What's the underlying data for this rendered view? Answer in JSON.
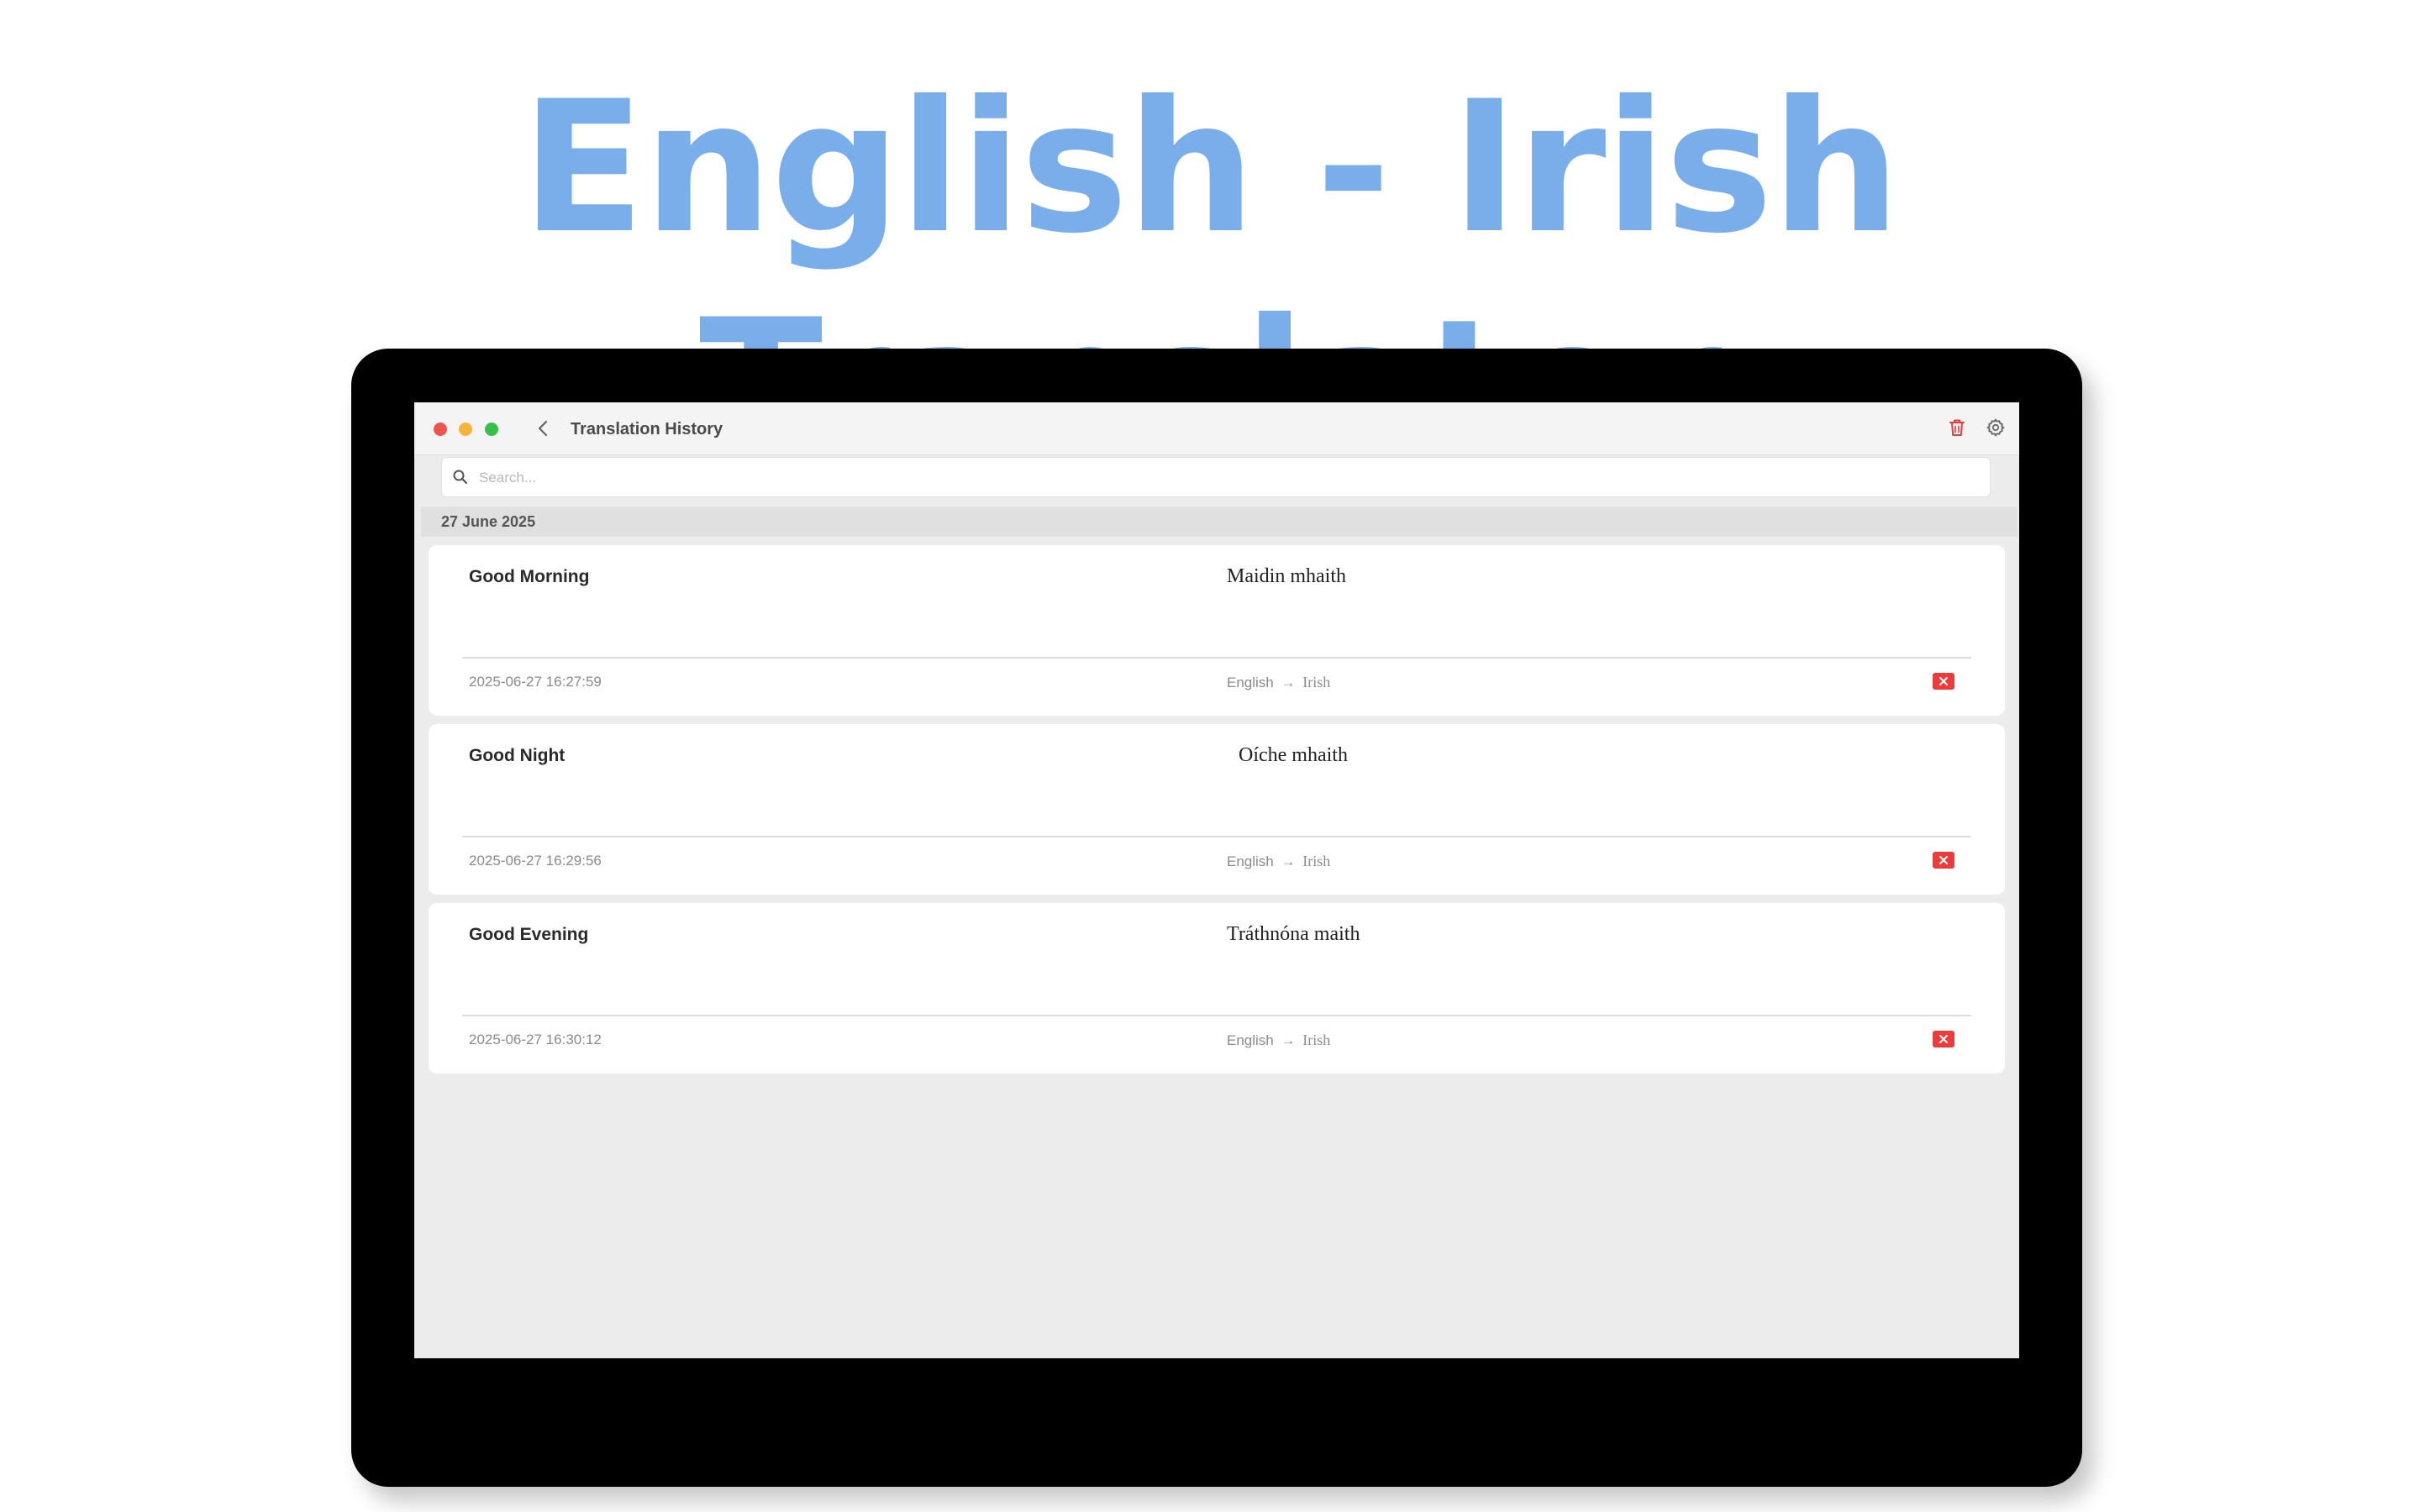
{
  "hero": {
    "title": "English - Irish Translator"
  },
  "window": {
    "title": "Translation History",
    "icons": {
      "back": "chevron-left-icon",
      "delete_all": "trash-icon",
      "settings": "gear-icon"
    }
  },
  "search": {
    "placeholder": "Search...",
    "value": ""
  },
  "history": {
    "section_date": "27 June 2025",
    "entries": [
      {
        "source": "Good Morning",
        "target": "Maidin mhaith",
        "timestamp": "2025-06-27 16:27:59",
        "from_lang": "English",
        "arrow": "→",
        "to_lang": "Irish"
      },
      {
        "source": "Good Night",
        "target": "Oíche mhaith",
        "timestamp": "2025-06-27 16:29:56",
        "from_lang": "English",
        "arrow": "→",
        "to_lang": "Irish"
      },
      {
        "source": "Good Evening",
        "target": "Tráthnóna maith",
        "timestamp": "2025-06-27 16:30:12",
        "from_lang": "English",
        "arrow": "→",
        "to_lang": "Irish"
      }
    ]
  },
  "colors": {
    "hero": "#7aaeeb",
    "delete": "#ec3b3b",
    "traffic_red": "#ef5350",
    "traffic_yellow": "#f4b43a",
    "traffic_green": "#35c04a"
  }
}
